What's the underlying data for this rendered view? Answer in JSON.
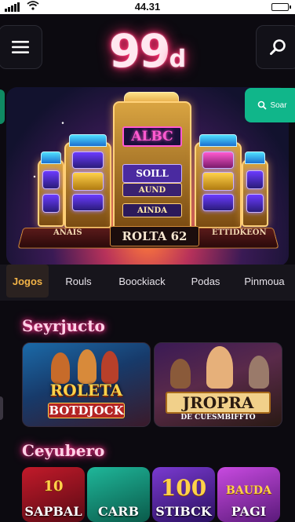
{
  "status_bar": {
    "time": "44.31"
  },
  "header": {
    "logo_main": "99",
    "logo_suffix": "d"
  },
  "hero": {
    "pill_text": "Soar",
    "reel_top": "ALBC",
    "reel_2": "SOILL",
    "reel_3": "AUND",
    "reel_4": "AINDA",
    "platform_left": "ANAIS",
    "platform_center": "ROLTA  62",
    "platform_right": "ETTIDKEON"
  },
  "tabs": [
    "Jogos",
    "Rouls",
    "Boockiack",
    "Podas",
    "Pinmoua"
  ],
  "sections": [
    {
      "title": "Seyrjucto",
      "cards": [
        {
          "line1": "ROLETA",
          "line2": "BOTDJOCK"
        },
        {
          "line1": "JROPRA",
          "line2": "DE CUESMBIFFTO"
        }
      ]
    },
    {
      "title": "Ceyubero",
      "small_cards": [
        {
          "top": "10",
          "label": "SAPBAL"
        },
        {
          "top": "",
          "label": "CARB"
        },
        {
          "top": "100",
          "label": "STIBCK"
        },
        {
          "top": "BAUDA",
          "label": "PAGI"
        }
      ]
    }
  ],
  "colors": {
    "accent_pink": "#ff2d6e",
    "tab_active": "#f2b347",
    "pill_green": "#10b68a"
  }
}
